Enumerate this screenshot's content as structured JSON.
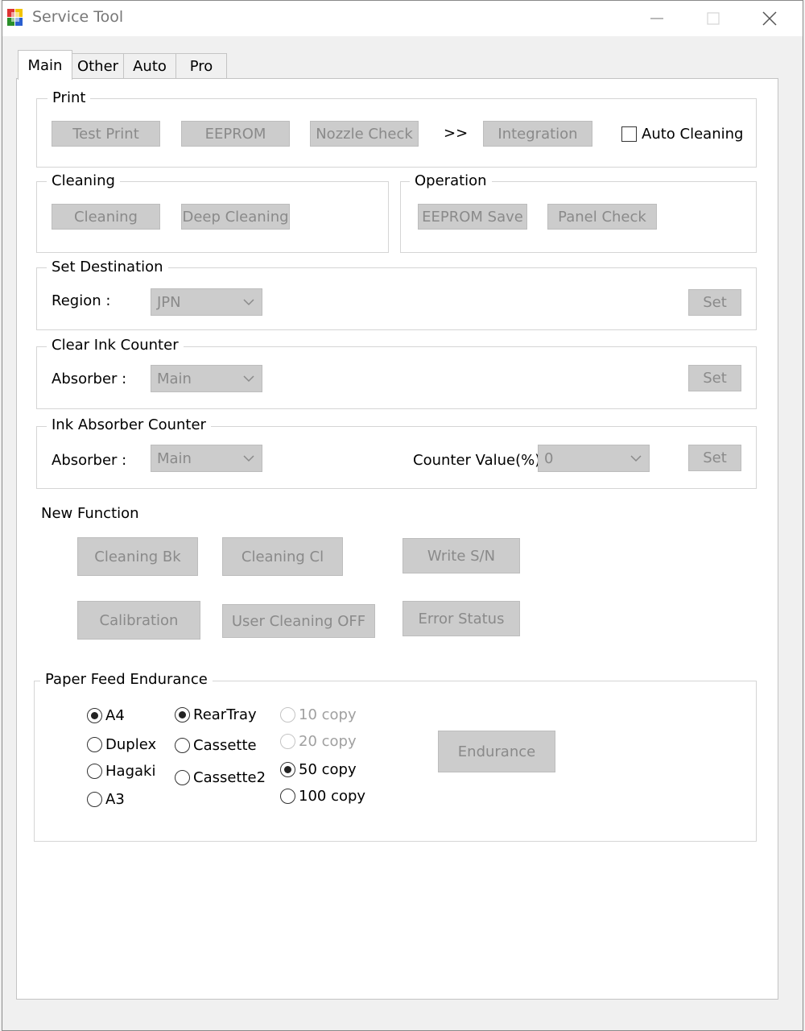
{
  "window": {
    "title": "Service Tool"
  },
  "tabs": [
    {
      "label": "Main",
      "active": true
    },
    {
      "label": "Other",
      "active": false
    },
    {
      "label": "Auto",
      "active": false
    },
    {
      "label": "Pro",
      "active": false
    }
  ],
  "print_group": {
    "title": "Print",
    "test_print": "Test Print",
    "eeprom": "EEPROM",
    "nozzle_check": "Nozzle Check",
    "arrow": ">>",
    "integration": "Integration",
    "auto_cleaning": {
      "label": "Auto Cleaning",
      "checked": false
    }
  },
  "cleaning_group": {
    "title": "Cleaning",
    "cleaning": "Cleaning",
    "deep_cleaning": "Deep Cleaning"
  },
  "operation_group": {
    "title": "Operation",
    "eeprom_save": "EEPROM Save",
    "panel_check": "Panel Check"
  },
  "set_destination": {
    "title": "Set Destination",
    "region_label": "Region :",
    "region_value": "JPN",
    "set_label": "Set"
  },
  "clear_ink_counter": {
    "title": "Clear Ink Counter",
    "absorber_label": "Absorber :",
    "absorber_value": "Main",
    "set_label": "Set"
  },
  "ink_absorber_counter": {
    "title": "Ink Absorber Counter",
    "absorber_label": "Absorber :",
    "absorber_value": "Main",
    "counter_label": "Counter Value(%) :",
    "counter_value": "0",
    "set_label": "Set"
  },
  "new_function": {
    "title": "New Function",
    "cleaning_bk": "Cleaning Bk",
    "cleaning_cl": "Cleaning Cl",
    "write_sn": "Write S/N",
    "calibration": "Calibration",
    "user_cleaning_off": "User Cleaning OFF",
    "error_status": "Error Status"
  },
  "paper_feed": {
    "title": "Paper Feed Endurance",
    "paper_size": [
      {
        "label": "A4",
        "selected": true
      },
      {
        "label": "Duplex",
        "selected": false
      },
      {
        "label": "Hagaki",
        "selected": false
      },
      {
        "label": "A3",
        "selected": false
      }
    ],
    "tray": [
      {
        "label": "RearTray",
        "selected": true
      },
      {
        "label": "Cassette",
        "selected": false
      },
      {
        "label": "Cassette2",
        "selected": false
      }
    ],
    "copies": [
      {
        "label": "10 copy",
        "selected": false,
        "disabled": true
      },
      {
        "label": "20 copy",
        "selected": false,
        "disabled": true
      },
      {
        "label": "50 copy",
        "selected": true,
        "disabled": false
      },
      {
        "label": "100 copy",
        "selected": false,
        "disabled": false
      }
    ],
    "endurance_label": "Endurance"
  },
  "icons": {
    "app": "app-icon",
    "minimize": "minimize-icon",
    "maximize": "maximize-icon",
    "close": "close-icon",
    "dropdown": "chevron-down-icon"
  }
}
